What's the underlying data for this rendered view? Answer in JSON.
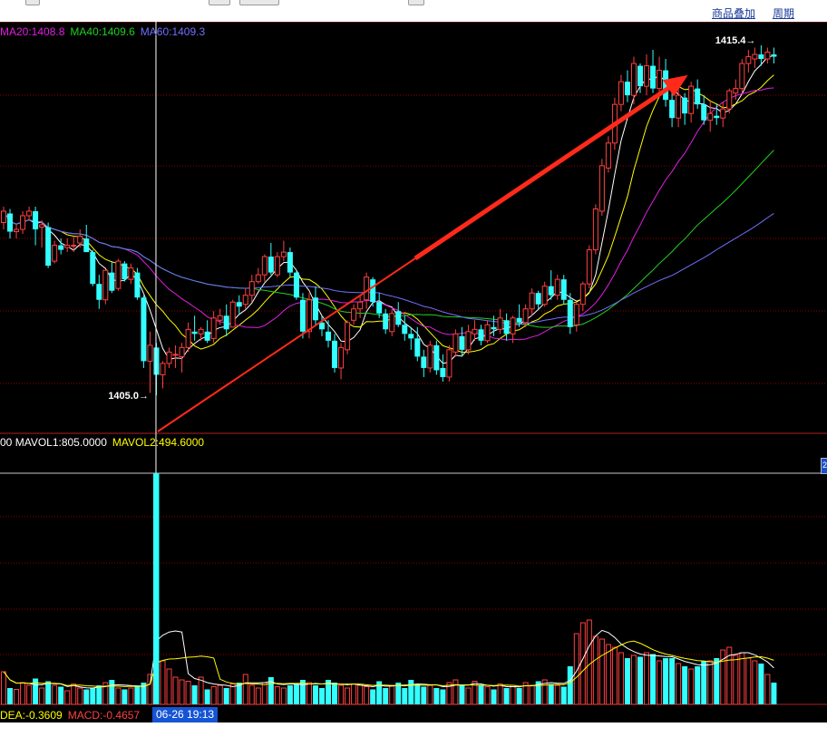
{
  "toolbar": {
    "overlay_label": "商品叠加",
    "period_label": "周期"
  },
  "legend": {
    "ma20_label": "MA20:1408.8",
    "ma40_label": "MA40:1409.6",
    "ma60_label": "MA60:1409.3",
    "ma20_color": "#e020e0",
    "ma40_color": "#20d020",
    "ma60_color": "#7070ff"
  },
  "volume_legend": {
    "prefix": "00",
    "mavol1_label": "MAVOL1:805.0000",
    "mavol2_label": "MAVOL2:494.6000",
    "mavol1_color": "#ffffff",
    "mavol2_color": "#ffff00"
  },
  "macd_legend": {
    "dea_label": "DEA:-0.3609",
    "macd_label": "MACD:-0.4657",
    "dea_color": "#ffff00",
    "macd_color": "#ff4040"
  },
  "crosshair": {
    "time_label": "06-26 19:13",
    "time_label_color": "#1554d4"
  },
  "annotations": {
    "high_label": "1415.4",
    "low_label": "1405.0"
  },
  "colors": {
    "up": "#ff4040",
    "down": "#33ffff",
    "grid": "#8b0000",
    "arrow": "#ff2a1a",
    "ma5": "#ffffff",
    "ma10": "#ffff00"
  },
  "chart_data": {
    "type": "candlestick",
    "price_axis": {
      "low": 1405.0,
      "high": 1415.4
    },
    "candles_ohlc": [
      [
        1407.6,
        1408.3,
        1407.3,
        1408.1
      ],
      [
        1408.0,
        1408.2,
        1406.9,
        1407.2
      ],
      [
        1407.2,
        1407.5,
        1406.9,
        1407.3
      ],
      [
        1407.3,
        1408.1,
        1407.1,
        1407.9
      ],
      [
        1407.9,
        1408.3,
        1407.7,
        1408.1
      ],
      [
        1408.1,
        1408.3,
        1406.6,
        1407.3
      ],
      [
        1407.4,
        1407.7,
        1406.5,
        1407.5
      ],
      [
        1407.4,
        1407.6,
        1405.6,
        1405.7
      ],
      [
        1405.9,
        1406.8,
        1405.8,
        1406.6
      ],
      [
        1406.6,
        1406.9,
        1406.2,
        1406.4
      ],
      [
        1406.5,
        1406.9,
        1406.3,
        1406.6
      ],
      [
        1406.6,
        1407.0,
        1406.3,
        1406.6
      ],
      [
        1406.7,
        1407.3,
        1406.5,
        1407.0
      ],
      [
        1406.9,
        1407.5,
        1406.3,
        1406.3
      ],
      [
        1406.3,
        1406.4,
        1404.8,
        1404.9
      ],
      [
        1404.9,
        1405.3,
        1403.8,
        1404.2
      ],
      [
        1404.2,
        1405.5,
        1404.0,
        1405.5
      ],
      [
        1405.4,
        1405.9,
        1404.5,
        1404.6
      ],
      [
        1404.7,
        1406.0,
        1404.6,
        1405.9
      ],
      [
        1405.8,
        1405.9,
        1405.0,
        1405.1
      ],
      [
        1405.1,
        1405.8,
        1404.9,
        1405.6
      ],
      [
        1405.4,
        1405.6,
        1404.2,
        1404.3
      ],
      [
        1404.3,
        1404.4,
        1401.2,
        1401.5
      ],
      [
        1401.5,
        1402.8,
        1400.1,
        1402.2
      ],
      [
        1402.1,
        1402.3,
        1400.0,
        1400.9
      ],
      [
        1400.9,
        1401.5,
        1400.3,
        1401.4
      ],
      [
        1401.4,
        1402.1,
        1401.2,
        1401.9
      ],
      [
        1401.8,
        1402.2,
        1401.2,
        1401.8
      ],
      [
        1401.7,
        1402.3,
        1401.0,
        1402.1
      ],
      [
        1402.1,
        1403.2,
        1401.9,
        1402.9
      ],
      [
        1402.8,
        1403.5,
        1402.4,
        1402.7
      ],
      [
        1402.7,
        1403.0,
        1402.4,
        1402.9
      ],
      [
        1402.8,
        1403.3,
        1402.3,
        1402.4
      ],
      [
        1402.5,
        1403.7,
        1402.3,
        1403.4
      ],
      [
        1403.3,
        1403.8,
        1403.1,
        1403.5
      ],
      [
        1403.5,
        1404.0,
        1402.6,
        1402.9
      ],
      [
        1403.0,
        1404.2,
        1403.0,
        1404.1
      ],
      [
        1404.1,
        1404.4,
        1403.6,
        1403.9
      ],
      [
        1404.0,
        1404.7,
        1403.8,
        1404.4
      ],
      [
        1404.4,
        1405.3,
        1404.1,
        1405.0
      ],
      [
        1405.0,
        1405.6,
        1404.9,
        1405.3
      ],
      [
        1405.3,
        1406.2,
        1405.0,
        1406.1
      ],
      [
        1406.1,
        1406.7,
        1405.3,
        1405.4
      ],
      [
        1405.3,
        1406.3,
        1405.2,
        1406.1
      ],
      [
        1406.1,
        1406.8,
        1405.9,
        1406.3
      ],
      [
        1406.3,
        1406.5,
        1405.2,
        1405.4
      ],
      [
        1405.4,
        1405.5,
        1404.2,
        1404.3
      ],
      [
        1404.2,
        1404.5,
        1402.5,
        1402.8
      ],
      [
        1402.8,
        1404.5,
        1402.5,
        1404.2
      ],
      [
        1404.3,
        1404.8,
        1403.1,
        1403.3
      ],
      [
        1403.2,
        1403.5,
        1402.6,
        1402.9
      ],
      [
        1402.8,
        1403.3,
        1402.1,
        1402.4
      ],
      [
        1402.4,
        1402.7,
        1401.0,
        1401.2
      ],
      [
        1401.2,
        1402.3,
        1400.7,
        1402.1
      ],
      [
        1402.0,
        1403.3,
        1401.8,
        1403.2
      ],
      [
        1403.3,
        1404.0,
        1403.1,
        1403.8
      ],
      [
        1403.8,
        1404.4,
        1403.4,
        1404.1
      ],
      [
        1404.2,
        1405.4,
        1403.8,
        1405.2
      ],
      [
        1405.1,
        1405.2,
        1403.9,
        1404.1
      ],
      [
        1404.1,
        1404.5,
        1403.4,
        1403.6
      ],
      [
        1403.6,
        1403.8,
        1402.7,
        1402.9
      ],
      [
        1402.8,
        1403.8,
        1402.6,
        1403.6
      ],
      [
        1403.7,
        1404.1,
        1403.0,
        1403.1
      ],
      [
        1403.1,
        1403.5,
        1402.4,
        1402.7
      ],
      [
        1402.7,
        1403.0,
        1402.0,
        1402.5
      ],
      [
        1402.5,
        1403.0,
        1401.5,
        1401.7
      ],
      [
        1401.7,
        1402.0,
        1400.8,
        1401.2
      ],
      [
        1401.2,
        1402.4,
        1401.0,
        1402.2
      ],
      [
        1402.2,
        1402.4,
        1400.9,
        1401.1
      ],
      [
        1401.2,
        1401.8,
        1400.6,
        1400.8
      ],
      [
        1400.8,
        1402.2,
        1400.6,
        1402.0
      ],
      [
        1401.9,
        1402.9,
        1401.7,
        1402.7
      ],
      [
        1402.6,
        1403.0,
        1401.7,
        1402.0
      ],
      [
        1402.0,
        1403.1,
        1401.8,
        1402.8
      ],
      [
        1402.7,
        1403.3,
        1402.4,
        1402.9
      ],
      [
        1402.9,
        1403.1,
        1402.2,
        1402.4
      ],
      [
        1402.4,
        1403.3,
        1402.3,
        1403.1
      ],
      [
        1403.0,
        1403.5,
        1402.6,
        1402.9
      ],
      [
        1402.9,
        1403.8,
        1402.7,
        1403.4
      ],
      [
        1403.3,
        1403.6,
        1402.4,
        1402.7
      ],
      [
        1402.7,
        1403.5,
        1402.3,
        1403.4
      ],
      [
        1403.4,
        1404.0,
        1403.0,
        1403.2
      ],
      [
        1403.2,
        1404.0,
        1403.0,
        1403.8
      ],
      [
        1403.8,
        1404.7,
        1403.5,
        1404.5
      ],
      [
        1404.5,
        1404.6,
        1403.8,
        1404.0
      ],
      [
        1404.0,
        1405.0,
        1403.9,
        1404.8
      ],
      [
        1404.8,
        1405.5,
        1404.2,
        1404.4
      ],
      [
        1404.4,
        1405.3,
        1404.2,
        1405.1
      ],
      [
        1405.1,
        1405.3,
        1404.0,
        1404.2
      ],
      [
        1404.2,
        1404.5,
        1402.7,
        1403.0
      ],
      [
        1403.1,
        1404.1,
        1402.8,
        1404.0
      ],
      [
        1404.0,
        1405.0,
        1403.7,
        1404.9
      ],
      [
        1404.9,
        1406.6,
        1404.7,
        1406.4
      ],
      [
        1406.4,
        1408.4,
        1406.2,
        1408.2
      ],
      [
        1408.1,
        1410.4,
        1407.9,
        1410.1
      ],
      [
        1410.0,
        1411.4,
        1409.8,
        1411.1
      ],
      [
        1411.1,
        1413.1,
        1410.8,
        1412.8
      ],
      [
        1412.8,
        1414.1,
        1412.5,
        1413.8
      ],
      [
        1413.8,
        1414.3,
        1412.9,
        1413.2
      ],
      [
        1413.2,
        1414.9,
        1412.8,
        1414.6
      ],
      [
        1414.5,
        1414.6,
        1413.3,
        1413.6
      ],
      [
        1413.6,
        1415.0,
        1413.2,
        1414.5
      ],
      [
        1414.5,
        1415.2,
        1413.3,
        1413.5
      ],
      [
        1413.5,
        1414.9,
        1413.1,
        1414.3
      ],
      [
        1414.3,
        1414.8,
        1412.7,
        1413.0
      ],
      [
        1413.0,
        1413.5,
        1411.8,
        1412.2
      ],
      [
        1412.2,
        1413.6,
        1411.8,
        1413.2
      ],
      [
        1413.1,
        1413.3,
        1411.9,
        1412.4
      ],
      [
        1412.4,
        1413.8,
        1412.0,
        1413.6
      ],
      [
        1413.5,
        1413.9,
        1412.6,
        1412.8
      ],
      [
        1412.8,
        1413.2,
        1411.9,
        1412.1
      ],
      [
        1412.1,
        1413.0,
        1411.6,
        1412.4
      ],
      [
        1412.3,
        1412.8,
        1411.9,
        1412.2
      ],
      [
        1412.2,
        1412.9,
        1411.8,
        1412.6
      ],
      [
        1412.6,
        1413.5,
        1412.4,
        1413.4
      ],
      [
        1413.3,
        1413.9,
        1413.0,
        1413.5
      ],
      [
        1413.5,
        1414.8,
        1413.3,
        1414.6
      ],
      [
        1414.6,
        1415.2,
        1414.2,
        1414.9
      ],
      [
        1414.8,
        1415.3,
        1414.4,
        1415.0
      ],
      [
        1415.0,
        1415.4,
        1414.5,
        1414.8
      ],
      [
        1414.8,
        1415.3,
        1414.6,
        1415.1
      ],
      [
        1415.0,
        1415.3,
        1414.6,
        1414.9
      ]
    ],
    "volumes": [
      120,
      60,
      55,
      80,
      70,
      95,
      60,
      85,
      70,
      65,
      50,
      75,
      60,
      55,
      60,
      70,
      80,
      90,
      60,
      55,
      60,
      70,
      80,
      110,
      850,
      160,
      130,
      100,
      90,
      85,
      70,
      100,
      55,
      65,
      70,
      60,
      75,
      80,
      110,
      70,
      60,
      80,
      100,
      65,
      60,
      70,
      75,
      90,
      80,
      70,
      60,
      90,
      80,
      70,
      60,
      75,
      70,
      65,
      55,
      85,
      60,
      70,
      80,
      60,
      90,
      75,
      65,
      70,
      60,
      55,
      80,
      90,
      70,
      60,
      85,
      70,
      65,
      55,
      75,
      60,
      70,
      60,
      80,
      70,
      85,
      90,
      75,
      70,
      65,
      140,
      260,
      300,
      310,
      250,
      240,
      220,
      210,
      190,
      170,
      180,
      175,
      190,
      185,
      160,
      170,
      170,
      150,
      140,
      130,
      140,
      160,
      160,
      170,
      200,
      210,
      180,
      190,
      170,
      160,
      150,
      110,
      80
    ],
    "moving_averages": [
      "MA5",
      "MA10",
      "MA20",
      "MA40",
      "MA60"
    ],
    "volume_averages": [
      "MAVOL1",
      "MAVOL2"
    ]
  }
}
